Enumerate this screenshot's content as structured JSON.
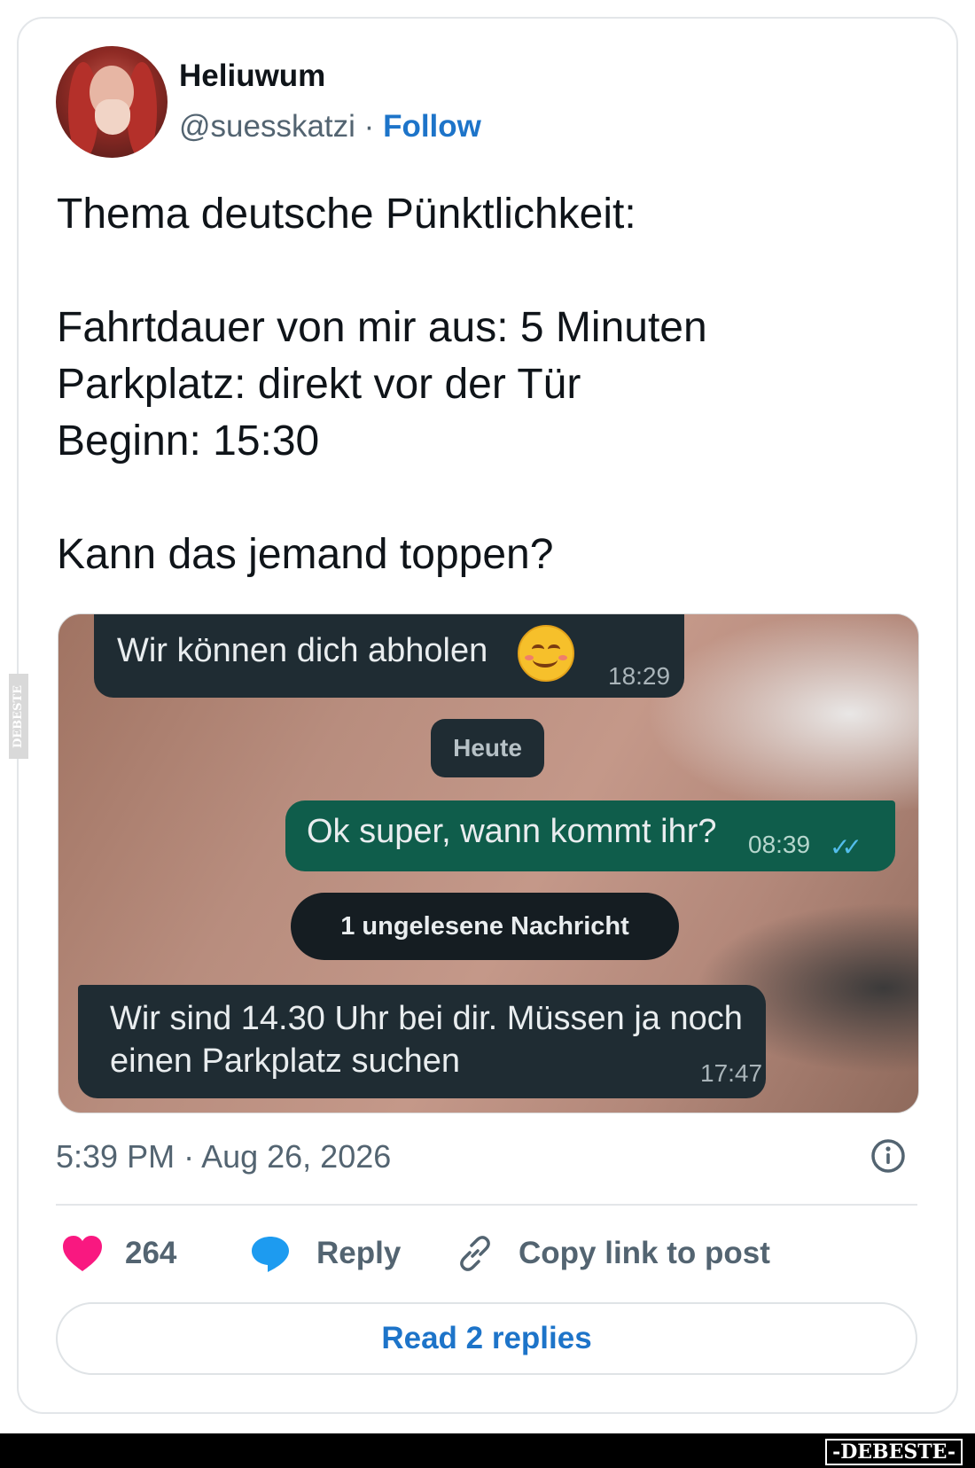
{
  "author": {
    "name": "Heliuwum",
    "handle": "@suesskatzi",
    "separator": "·",
    "follow_label": "Follow"
  },
  "tweet": {
    "lines": [
      "Thema deutsche Pünktlichkeit:",
      "",
      "Fahrtdauer von mir aus: 5 Minuten",
      "Parkplatz: direkt vor der Tür",
      "Beginn: 15:30",
      "",
      "Kann das jemand toppen?"
    ],
    "timestamp": "5:39 PM · Aug 26, 2026"
  },
  "chat": {
    "incoming_1": {
      "text": "Wir können dich abholen",
      "time": "18:29"
    },
    "day_label": "Heute",
    "outgoing": {
      "text": "Ok super, wann kommt ihr?",
      "time": "08:39"
    },
    "unread_label": "1 ungelesene Nachricht",
    "incoming_2": {
      "text": "Wir sind 14.30 Uhr bei dir. Müssen ja noch einen Parkplatz suchen",
      "time": "17:47"
    }
  },
  "actions": {
    "like_count": "264",
    "reply_label": "Reply",
    "copy_label": "Copy link to post",
    "read_replies_label": "Read 2 replies"
  },
  "watermark": {
    "side_text": "DEBESTE",
    "bottom_text": "-DEBESTE-"
  },
  "colors": {
    "link": "#1d74c9",
    "like": "#f91880",
    "reply_icon": "#1d9bf0",
    "chat_incoming": "#1f2c33",
    "chat_outgoing": "#0f5d4b"
  }
}
